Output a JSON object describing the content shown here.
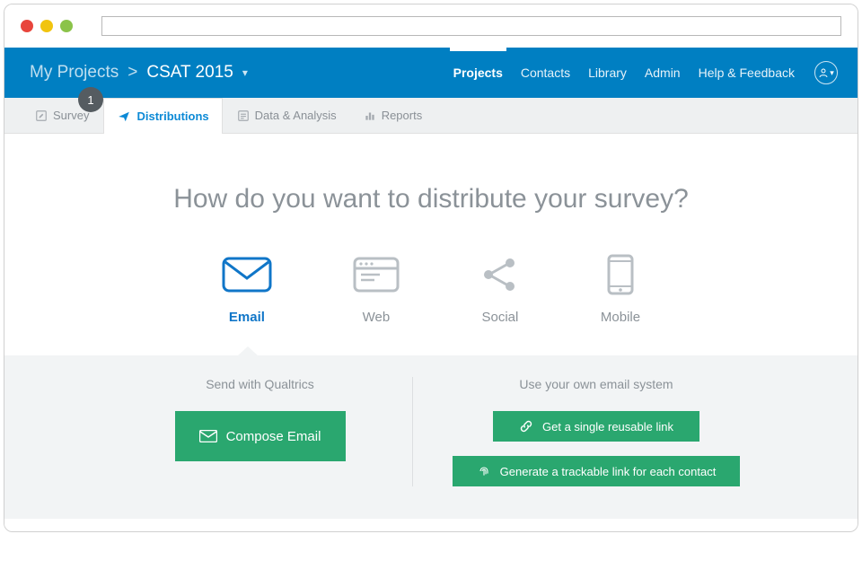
{
  "callout": "1",
  "breadcrumb": {
    "root": "My Projects",
    "sep": ">",
    "project": "CSAT 2015"
  },
  "topnav": {
    "projects": "Projects",
    "contacts": "Contacts",
    "library": "Library",
    "admin": "Admin",
    "help": "Help & Feedback"
  },
  "tabs": {
    "survey": "Survey",
    "distributions": "Distributions",
    "data": "Data & Analysis",
    "reports": "Reports"
  },
  "headline": "How do you want to distribute your survey?",
  "methods": {
    "email": "Email",
    "web": "Web",
    "social": "Social",
    "mobile": "Mobile"
  },
  "options": {
    "left_title": "Send with Qualtrics",
    "right_title": "Use your own email system",
    "compose": "Compose Email",
    "reusable": "Get a single reusable link",
    "trackable": "Generate a trackable link for each contact"
  }
}
